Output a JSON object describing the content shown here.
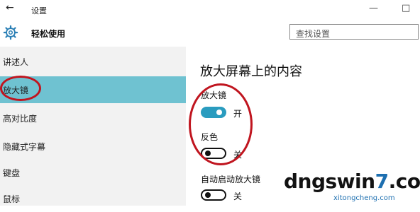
{
  "window": {
    "back": "←",
    "title": "设置",
    "minimize": "—",
    "maximize": "□"
  },
  "header": {
    "title": "轻松使用",
    "search_placeholder": "查找设置"
  },
  "sidebar": {
    "items": [
      {
        "label": "讲述人"
      },
      {
        "label": "放大镜",
        "selected": true
      },
      {
        "label": "高对比度"
      },
      {
        "label": "隐藏式字幕"
      },
      {
        "label": "键盘"
      },
      {
        "label": "鼠标"
      }
    ]
  },
  "main": {
    "title": "放大屏幕上的内容",
    "settings": [
      {
        "label": "放大镜",
        "state": "开",
        "on": true
      },
      {
        "label": "反色",
        "state": "关",
        "on": false
      },
      {
        "label": "自动启动放大镜",
        "state": "关",
        "on": false
      }
    ]
  },
  "watermark": {
    "brand_a": "dngswin",
    "brand_b": "7",
    "brand_c": ".com",
    "sub": "xitongcheng.com"
  },
  "colors": {
    "selected": "#6fc2d1",
    "toggle_on": "#2a9cbf",
    "annotation": "#c0151f"
  }
}
